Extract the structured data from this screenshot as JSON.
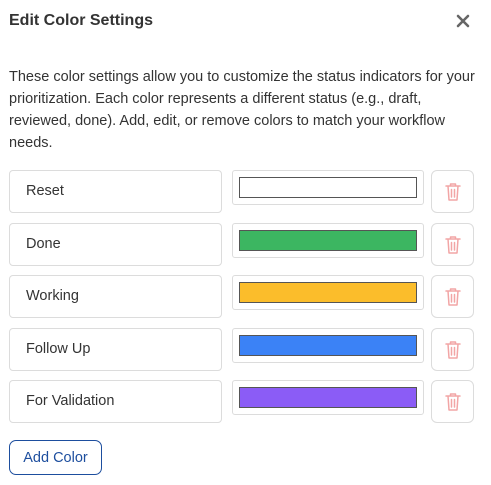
{
  "dialog": {
    "title": "Edit Color Settings",
    "close_icon": "close-icon",
    "description": "These color settings allow you to customize the status indicators for your prioritization. Each color represents a different status (e.g., draft, reviewed, done). Add, edit, or remove colors to match your workflow needs."
  },
  "colors": [
    {
      "name": "Reset",
      "color": "#ffffff"
    },
    {
      "name": "Done",
      "color": "#3cb661"
    },
    {
      "name": "Working",
      "color": "#fbbd2b"
    },
    {
      "name": "Follow Up",
      "color": "#3b82f6"
    },
    {
      "name": "For Validation",
      "color": "#8b5cf6"
    }
  ],
  "delete_icon": "trash-icon",
  "delete_icon_color": "#f2a5a5",
  "add_button_label": "Add Color"
}
